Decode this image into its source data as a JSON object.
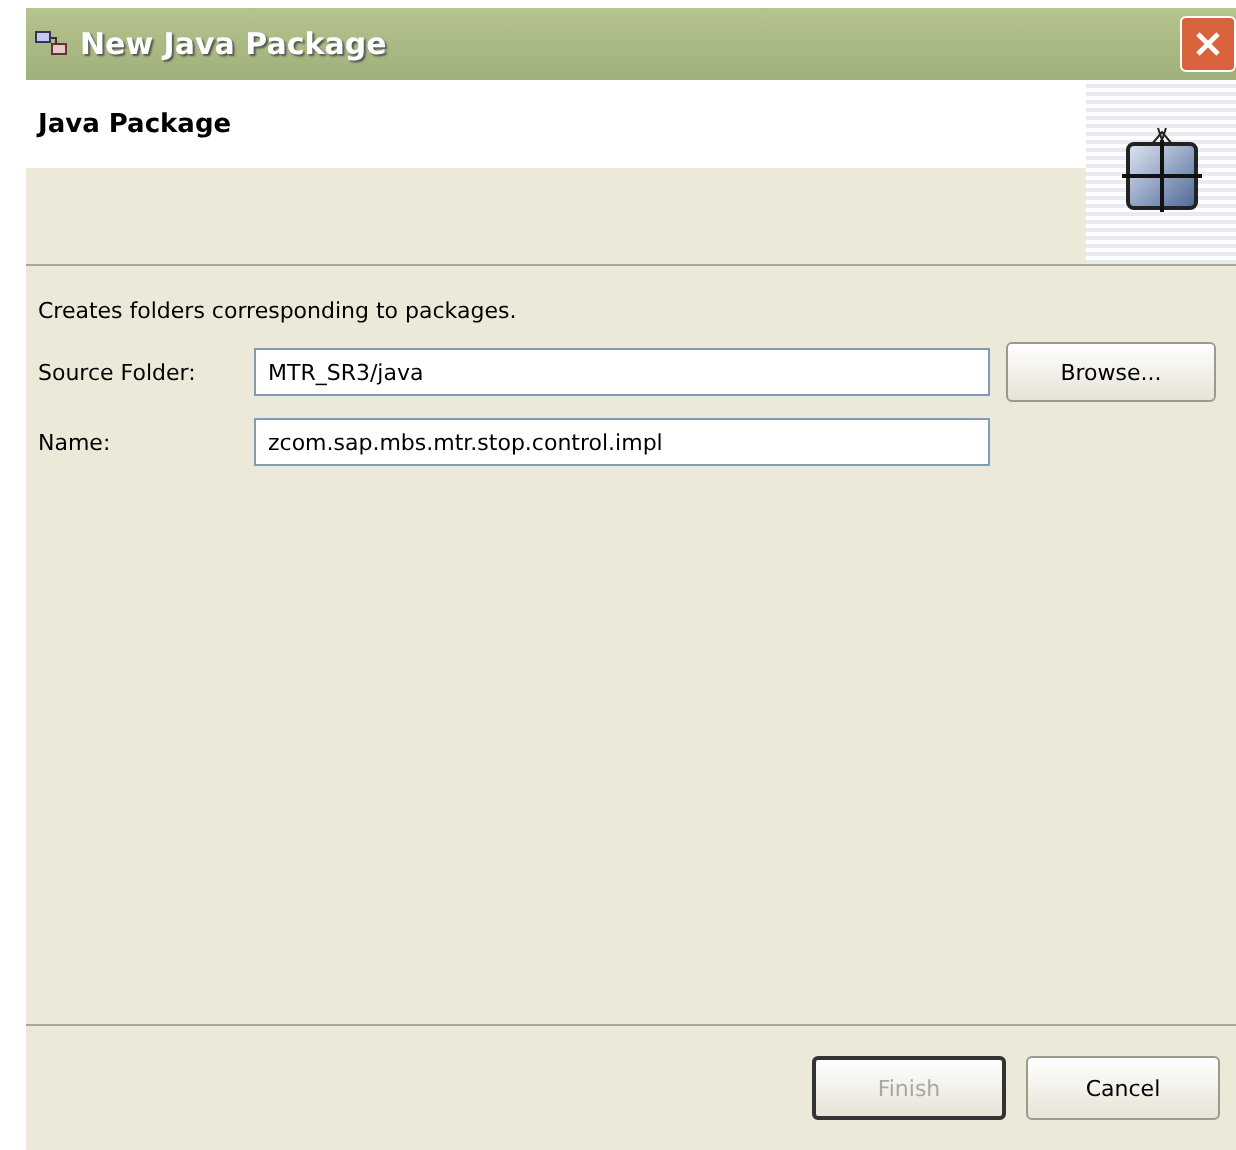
{
  "window": {
    "title": "New Java Package"
  },
  "header": {
    "title": "Java Package"
  },
  "description": "Creates folders corresponding to packages.",
  "fields": [
    {
      "label": "Source Folder:",
      "value": "MTR_SR3/java",
      "button": "Browse..."
    },
    {
      "label": "Name:",
      "value": "zcom.sap.mbs.mtr.stop.control.impl"
    }
  ],
  "buttons": [
    {
      "label": "Finish",
      "disabled": true
    },
    {
      "label": "Cancel",
      "disabled": false
    }
  ]
}
